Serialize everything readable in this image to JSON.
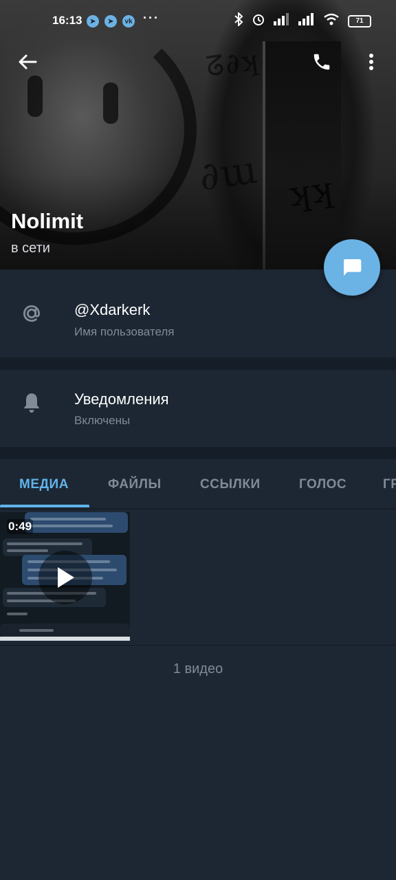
{
  "status_bar": {
    "time": "16:13",
    "battery": "71",
    "app_icons": [
      "telegram-icon",
      "telegram-icon",
      "vk-icon"
    ],
    "more": "···"
  },
  "profile": {
    "name": "Nolimit",
    "status": "в сети"
  },
  "info": {
    "username_value": "@Xdarkerk",
    "username_label": "Имя пользователя",
    "notifications_title": "Уведомления",
    "notifications_value": "Включены"
  },
  "tabs": [
    {
      "label": "МЕДИА",
      "active": true
    },
    {
      "label": "ФАЙЛЫ",
      "active": false
    },
    {
      "label": "ССЫЛКИ",
      "active": false
    },
    {
      "label": "ГОЛОС",
      "active": false
    },
    {
      "label": "ГР",
      "active": false
    }
  ],
  "media": {
    "video_duration": "0:49",
    "count_label": "1 видео"
  },
  "colors": {
    "background": "#1d2733",
    "accent": "#61b3ea",
    "fab": "#6bb2e5",
    "secondary_text": "#7f8b97"
  }
}
